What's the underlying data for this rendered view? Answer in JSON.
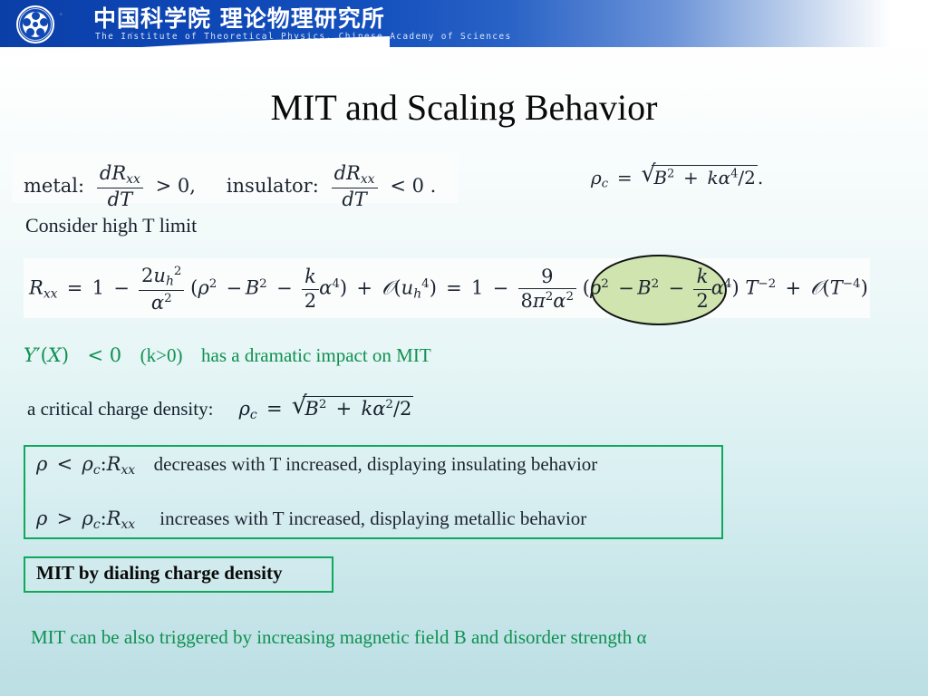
{
  "header": {
    "cn_title": "中国科学院 理论物理研究所",
    "en_title": "The Institute of Theoretical Physics, Chinese Academy of Sciences",
    "logo_name": "cas-atom-logo",
    "banner_color": "#0d46b4"
  },
  "slide": {
    "title": "MIT and Scaling Behavior"
  },
  "definitions": {
    "metal_label": "metal:",
    "metal_num": "d R",
    "metal_num_sub": "xx",
    "metal_den_d": "d",
    "metal_den_T": "T",
    "metal_rel": "> 0,",
    "insulator_label": "insulator:",
    "insulator_rel": "< 0 ."
  },
  "rho_c_top": {
    "lhs": "ρ",
    "lhs_sub": "c",
    "eq": "=",
    "under_B": "B",
    "under_B_sup": "2",
    "plus": "+",
    "k": "k",
    "alpha": "α",
    "alpha_sup": "4",
    "over_two": "/2",
    "period": "."
  },
  "consider_line": "Consider high T limit",
  "rxx_equation": {
    "R": "R",
    "R_sub": "xx",
    "eq1": "=",
    "one_a": "1",
    "minus_a": "−",
    "frac1_num_2": "2",
    "frac1_num_u": "u",
    "frac1_num_u_sub": "h",
    "frac1_num_u_sup": "2",
    "frac1_den_alpha": "α",
    "frac1_den_sup": "2",
    "open1": "(",
    "rho": "ρ",
    "rho_sup": "2",
    "minus_b": "−",
    "B": "B",
    "B_sup": "2",
    "minus_c": "−",
    "frac_k_num": "k",
    "frac_k_den": "2",
    "alpha1": "α",
    "alpha1_sup": "4",
    "close1": ")",
    "plus_O": "+",
    "Ocal": "𝒪",
    "O_open": "(",
    "O_u": "u",
    "O_u_sub": "h",
    "O_u_sup": "4",
    "O_close": ")",
    "eq2": "=",
    "one_b": "1",
    "minus_d": "−",
    "frac2_num": "9",
    "frac2_den_8": "8",
    "frac2_den_pi": "π",
    "frac2_den_pi_sup": "2",
    "frac2_den_alpha": "α",
    "frac2_den_alpha_sup": "2",
    "open2": "(",
    "rho2": "ρ",
    "rho2_sup": "2",
    "hl_minus_a": "−",
    "hl_B": "B",
    "hl_B_sup": "2",
    "hl_minus_b": "−",
    "hl_frac_num": "k",
    "hl_frac_den": "2",
    "hl_alpha": "α",
    "hl_alpha_sup": "4",
    "close2": ")",
    "T": "T",
    "T_sup": "−2",
    "plus_O2": "+",
    "Ocal2": "𝒪",
    "O2_open": "(",
    "O2_T": "T",
    "O2_T_sup": "−4",
    "O2_close": ")",
    "highlight_color": "#cfe4af"
  },
  "yprime_line": {
    "Y": "Y",
    "prime": "′",
    "open": "(",
    "X": "X",
    "close": ")",
    "rel": "< 0",
    "cond": "(k>0)",
    "tail": "has a dramatic impact on MIT",
    "color": "#0f9150"
  },
  "critical_density": {
    "label": "a critical charge density:",
    "rho": "ρ",
    "rho_sub": "c",
    "eq": "=",
    "B": "B",
    "B_sup": "2",
    "plus": "+",
    "k": "k",
    "alpha": "α",
    "alpha_sup": "2",
    "over_two": "/2"
  },
  "green_box": {
    "border_color": "#0fa85c",
    "line1": {
      "rho": "ρ",
      "rel": "<",
      "rho_c": "ρ",
      "rho_c_sub": "c",
      "colon": ":",
      "R": "R",
      "R_sub": "xx",
      "text": "decreases with T increased, displaying insulating behavior"
    },
    "line2": {
      "rho": "ρ",
      "rel": ">",
      "rho_c": "ρ",
      "rho_c_sub": "c",
      "colon": ":",
      "R": "R",
      "R_sub": "xx",
      "text": "increases with T increased, displaying metallic behavior"
    }
  },
  "dial_box": {
    "text": "MIT by dialing charge density",
    "border_color": "#0fa85c"
  },
  "bottom_line": {
    "text": "MIT can be also triggered by increasing magnetic field B and disorder strength α",
    "color": "#0f9150"
  }
}
